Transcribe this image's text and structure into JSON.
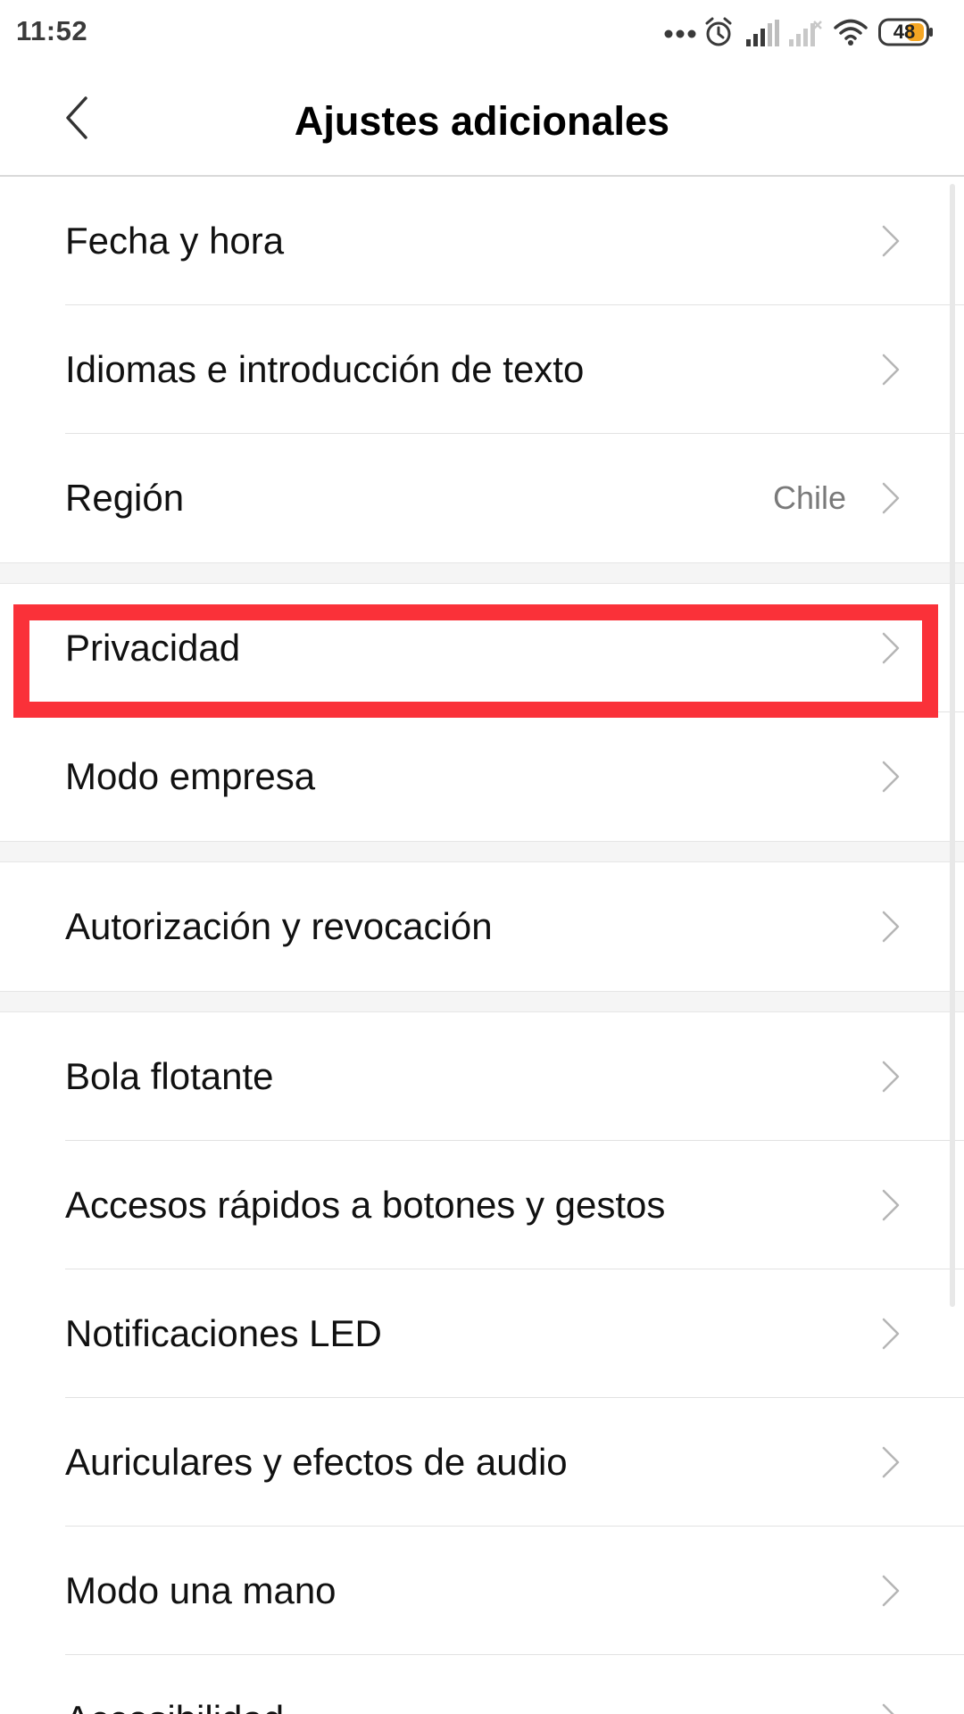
{
  "status_bar": {
    "time": "11:52",
    "battery_level": "48",
    "icons": [
      "more-dots-icon",
      "alarm-icon",
      "signal-icon",
      "signal-no-service-icon",
      "wifi-icon",
      "battery-icon"
    ]
  },
  "header": {
    "title": "Ajustes adicionales",
    "back_icon": "back-arrow-icon"
  },
  "groups": [
    {
      "items": [
        {
          "label": "Fecha y hora",
          "value": ""
        },
        {
          "label": "Idiomas e introducción de texto",
          "value": ""
        },
        {
          "label": "Región",
          "value": "Chile"
        }
      ]
    },
    {
      "items": [
        {
          "label": "Privacidad",
          "value": ""
        },
        {
          "label": "Modo empresa",
          "value": ""
        }
      ]
    },
    {
      "items": [
        {
          "label": "Autorización y revocación",
          "value": ""
        }
      ]
    },
    {
      "items": [
        {
          "label": "Bola flotante",
          "value": ""
        },
        {
          "label": "Accesos rápidos a botones y gestos",
          "value": ""
        },
        {
          "label": "Notificaciones LED",
          "value": ""
        },
        {
          "label": "Auriculares y efectos de audio",
          "value": ""
        },
        {
          "label": "Modo una mano",
          "value": ""
        },
        {
          "label": "Accesibilidad",
          "value": ""
        }
      ]
    }
  ],
  "highlight": {
    "target": "Privacidad",
    "color": "#fa3139"
  },
  "colors": {
    "text": "#111111",
    "secondary_text": "#7a7a7a",
    "chevron": "#b5b5b5",
    "divider": "#e2e2e2"
  }
}
